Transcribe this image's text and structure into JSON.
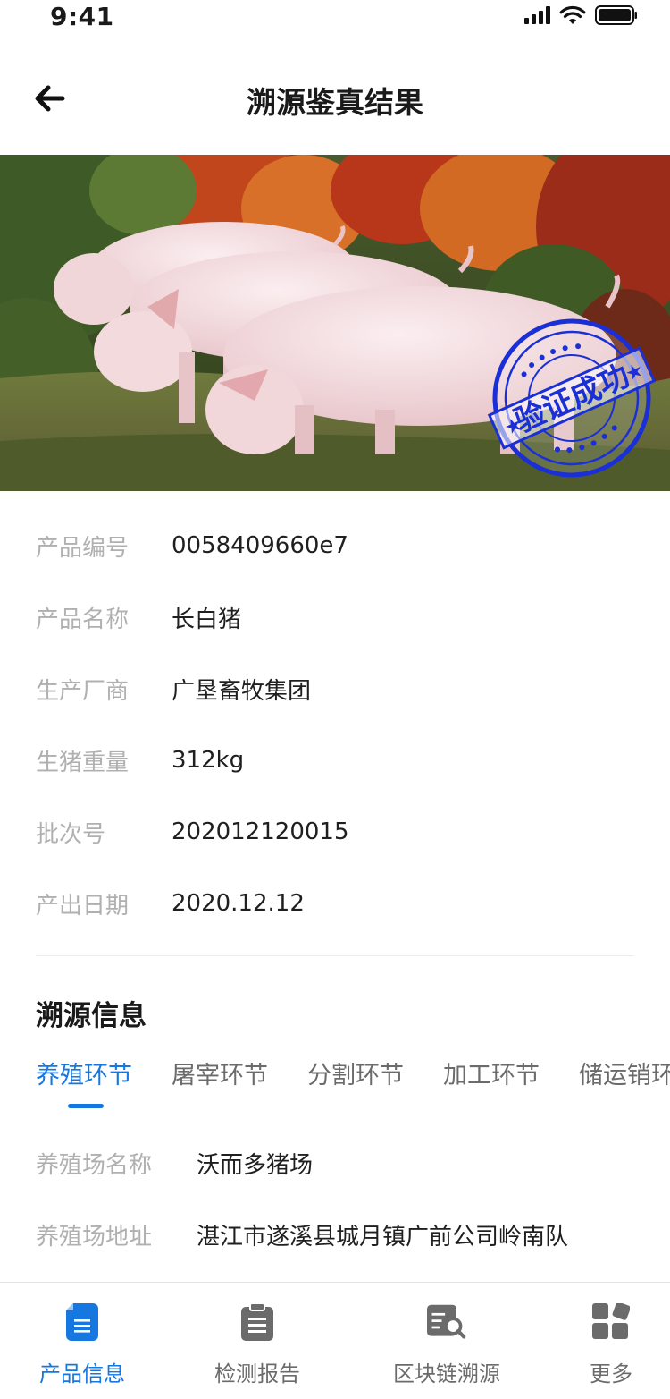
{
  "status_bar": {
    "time": "9:41"
  },
  "nav": {
    "title": "溯源鉴真结果",
    "back_icon": "arrow-left-icon"
  },
  "hero": {
    "stamp_text": "验证成功",
    "stamp_color": "#1a2fd6"
  },
  "product_info": [
    {
      "label": "产品编号",
      "value": "0058409660e7"
    },
    {
      "label": "产品名称",
      "value": "长白猪"
    },
    {
      "label": "生产厂商",
      "value": "广垦畜牧集团"
    },
    {
      "label": "生猪重量",
      "value": "312kg"
    },
    {
      "label": "批次号",
      "value": "202012120015"
    },
    {
      "label": "产出日期",
      "value": "2020.12.12"
    }
  ],
  "trace": {
    "title": "溯源信息",
    "tabs": [
      {
        "label": "养殖环节"
      },
      {
        "label": "屠宰环节"
      },
      {
        "label": "分割环节"
      },
      {
        "label": "加工环节"
      },
      {
        "label": "储运销环节"
      }
    ],
    "active_tab": 0,
    "details": [
      {
        "label": "养殖场名称",
        "value": "沃而多猪场"
      },
      {
        "label": "养殖场地址",
        "value": "湛江市遂溪县城月镇广前公司岭南队"
      }
    ]
  },
  "tabbar": {
    "items": [
      {
        "label": "产品信息",
        "icon": "document-icon"
      },
      {
        "label": "检测报告",
        "icon": "clipboard-icon"
      },
      {
        "label": "区块链溯源",
        "icon": "search-list-icon"
      },
      {
        "label": "更多",
        "icon": "grid-icon"
      }
    ],
    "active": 0
  },
  "colors": {
    "accent": "#1677e0",
    "label_gray": "#b0b0b0",
    "icon_gray": "#6b6b6b"
  }
}
